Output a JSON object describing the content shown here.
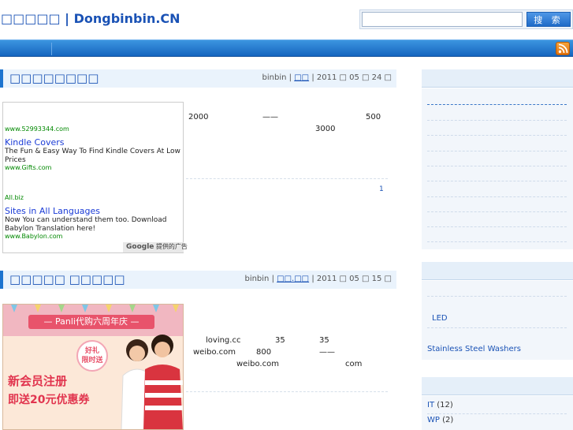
{
  "header": {
    "site_title": "□□□□□ | Dongbinbin.CN",
    "search_placeholder": "",
    "search_button": "搜 索"
  },
  "nav": {
    "rss_icon": "rss-icon"
  },
  "posts": [
    {
      "title": "□□□□□□□□",
      "author": "binbin",
      "category": "□□",
      "date": "| 2011 □ 05 □ 24 □"
    },
    {
      "title": "□□□□□ □□□□□",
      "author": "binbin",
      "category": "□□.□□",
      "date": "| 2011 □ 05 □ 15 □"
    }
  ],
  "post1_body": {
    "t1": "2000",
    "t2": "——",
    "t3": "500",
    "t4": "3000",
    "link": "1"
  },
  "ads": {
    "ad0_url": "www.52993344.com",
    "ad1_title": "Kindle Covers",
    "ad1_desc": "The Fun & Easy Way To Find Kindle Covers At Low Prices",
    "ad1_url": "www.Gifts.com",
    "ad2_sponsor": "All.biz",
    "ad2_title": "Sites in All Languages",
    "ad2_desc": "Now You can understand them too. Download Babylon Translation here!",
    "ad2_url": "www.Babylon.com",
    "google_label_brand": "Google",
    "google_label_text": "提供的广告"
  },
  "promo": {
    "banner": "— Panli代购六周年庆 —",
    "bubble": "好礼\n限时送",
    "line1": "新会员注册",
    "line2": "即送20元优惠券"
  },
  "post2_body": {
    "t1": "loving.cc",
    "t2": "35",
    "t3": "35",
    "t4": "weibo.com",
    "t5": "800",
    "t6": "——",
    "t7": "weibo.com",
    "t8": "com"
  },
  "sidebar": {
    "led": "LED",
    "washers": "Stainless Steel Washers",
    "categories": [
      {
        "name": "IT",
        "count": "(12)"
      },
      {
        "name": "WP",
        "count": "(2)"
      }
    ]
  },
  "colors": {
    "link": "#1a52b5",
    "nav_blue": "#1565bf",
    "accent_bar": "#1d74cf"
  }
}
